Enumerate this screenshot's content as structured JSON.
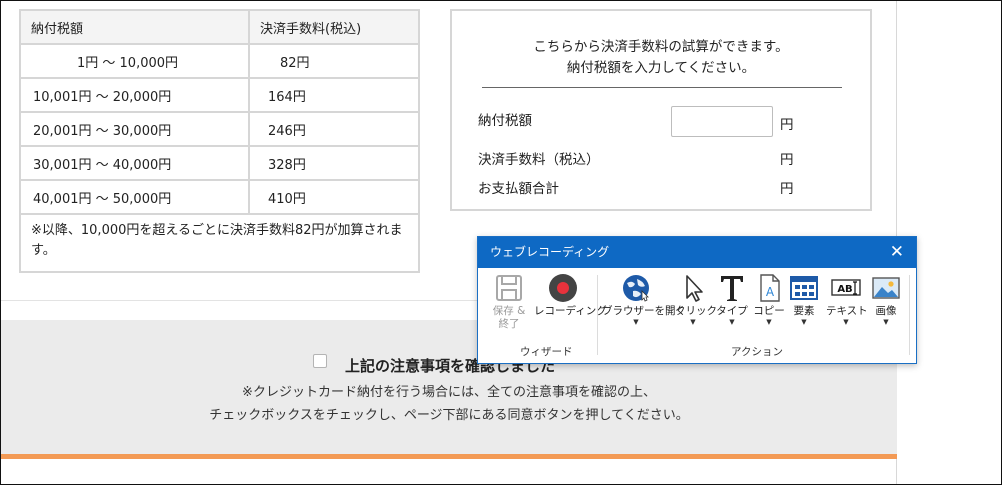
{
  "fee_table": {
    "headers": [
      "納付税額",
      "決済手数料(税込)"
    ],
    "rows": [
      {
        "range": "1円 ～ 10,000円",
        "fee": "82円"
      },
      {
        "range": "10,001円 ～ 20,000円",
        "fee": "164円"
      },
      {
        "range": "20,001円 ～ 30,000円",
        "fee": "246円"
      },
      {
        "range": "30,001円 ～ 40,000円",
        "fee": "328円"
      },
      {
        "range": "40,001円 ～ 50,000円",
        "fee": "410円"
      }
    ],
    "note": "※以降、10,000円を超えるごとに決済手数料82円が加算されます。"
  },
  "calculator": {
    "intro_line1": "こちらから決済手数料の試算ができます。",
    "intro_line2": "納付税額を入力してください。",
    "tax_label": "納付税額",
    "tax_value": "",
    "fee_label": "決済手数料（税込）",
    "total_label": "お支払額合計",
    "unit": "円"
  },
  "notice": {
    "checkbox_label": "上記の注意事項を確認しました",
    "checked": false,
    "line1": "※クレジットカード納付を行う場合には、全ての注意事項を確認の上、",
    "line2": "チェックボックスをチェックし、ページ下部にある同意ボタンを押してください。"
  },
  "recording_panel": {
    "title": "ウェブレコーディング",
    "groups": {
      "wizard": "ウィザード",
      "actions": "アクション"
    },
    "buttons": {
      "save": "保存 &\n終了",
      "record": "レコーディング",
      "open_browser": "ブラウザーを開く",
      "click": "クリック",
      "type": "タイプ",
      "copy": "コピー",
      "element": "要素",
      "text": "テキスト",
      "image": "画像"
    },
    "colors": {
      "titlebar": "#0e69c4",
      "record": "#e8323c"
    }
  }
}
